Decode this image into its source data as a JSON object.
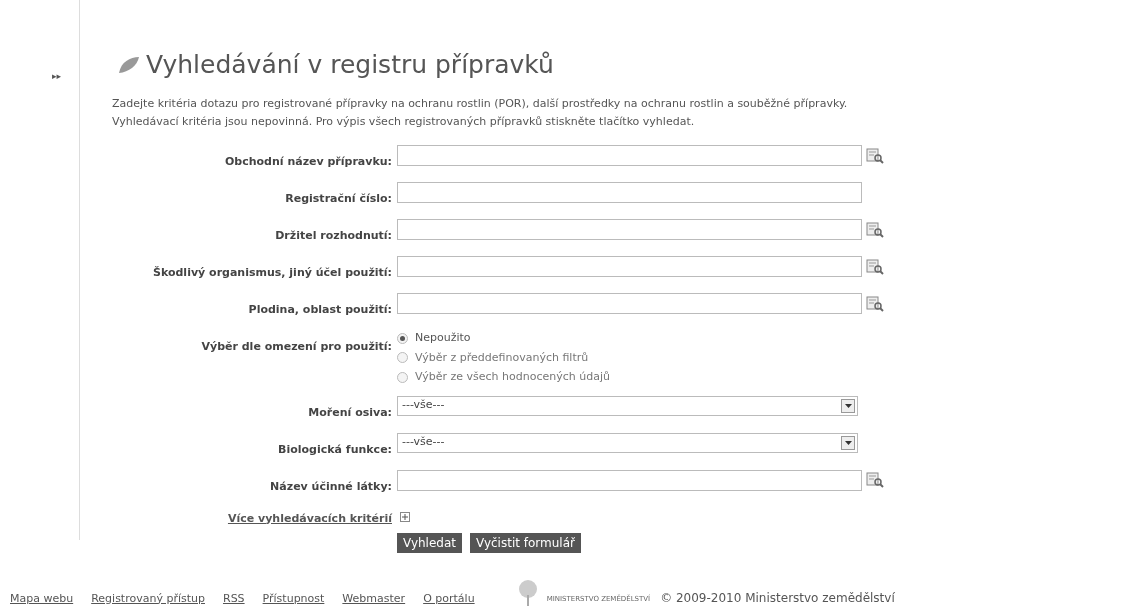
{
  "nav_toggle": "▸▸",
  "title": "Vyhledávání v registru přípravků",
  "intro": [
    "Zadejte kritéria dotazu pro registrované přípravky na ochranu rostlin (POR), další prostředky na ochranu rostlin a souběžné přípravky.",
    "Vyhledávací kritéria jsou nepovinná. Pro výpis všech registrovaných přípravků stiskněte tlačítko vyhledat."
  ],
  "fields": [
    {
      "kind": "text",
      "label": "Obchodní název přípravku:",
      "lookup": true
    },
    {
      "kind": "text",
      "label": "Registrační číslo:",
      "lookup": false
    },
    {
      "kind": "text",
      "label": "Držitel rozhodnutí:",
      "lookup": true
    },
    {
      "kind": "text",
      "label": "Škodlivý organismus, jiný účel použití:",
      "lookup": true
    },
    {
      "kind": "text",
      "label": "Plodina, oblast použití:",
      "lookup": true
    },
    {
      "kind": "radio",
      "label": "Výběr dle omezení pro použití:",
      "options": [
        {
          "label": "Nepoužito",
          "selected": true
        },
        {
          "label": "Výběr z předdefinovaných filtrů",
          "selected": false
        },
        {
          "label": "Výběr ze všech hodnocených údajů",
          "selected": false
        }
      ]
    },
    {
      "kind": "select",
      "label": "Moření osiva:",
      "value": "---vše---"
    },
    {
      "kind": "select",
      "label": "Biologická funkce:",
      "value": "---vše---"
    },
    {
      "kind": "text",
      "label": "Název účinné látky:",
      "lookup": true
    }
  ],
  "more_link": "Více vyhledávacích kritérií",
  "buttons": [
    "Vyhledat",
    "Vyčistit formulář"
  ],
  "footer": {
    "links": [
      "Mapa webu",
      "Registrovaný přístup",
      "RSS",
      "Přístupnost",
      "Webmaster",
      "O portálu"
    ],
    "logo_text": "MINISTERSTVO ZEMĚDĚLSTVÍ",
    "copyright": "© 2009-2010 Ministerstvo zemědělství"
  }
}
